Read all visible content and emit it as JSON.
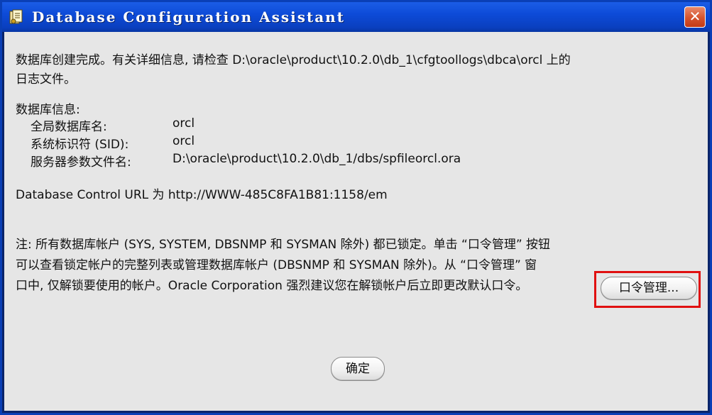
{
  "window": {
    "title": "Database Configuration Assistant",
    "close_label": "✕"
  },
  "message": {
    "line1": "数据库创建完成。有关详细信息, 请检查 D:\\oracle\\product\\10.2.0\\db_1\\cfgtoollogs\\dbca\\orcl 上的",
    "line2": "日志文件。"
  },
  "db_info": {
    "heading": "数据库信息:",
    "rows": [
      {
        "label": "全局数据库名:",
        "value": "orcl"
      },
      {
        "label": "系统标识符 (SID):",
        "value": "orcl"
      },
      {
        "label": "服务器参数文件名:",
        "value": "D:\\oracle\\product\\10.2.0\\db_1/dbs/spfileorcl.ora"
      }
    ]
  },
  "control_url": "Database Control URL 为 http://WWW-485C8FA1B81:1158/em",
  "note": {
    "line1": "注: 所有数据库帐户 (SYS, SYSTEM, DBSNMP 和 SYSMAN 除外) 都已锁定。单击 “口令管理” 按钮",
    "line2": "可以查看锁定帐户的完整列表或管理数据库帐户 (DBSNMP 和 SYSMAN 除外)。从 “口令管理” 窗",
    "line3": "口中, 仅解锁要使用的帐户。Oracle Corporation 强烈建议您在解锁帐户后立即更改默认口令。"
  },
  "buttons": {
    "password_management": "口令管理...",
    "ok": "确定"
  },
  "colors": {
    "title_bar": "#0d4bd8",
    "client_bg": "#e6e6e6",
    "highlight": "#e01010",
    "close_button": "#d5532d"
  }
}
